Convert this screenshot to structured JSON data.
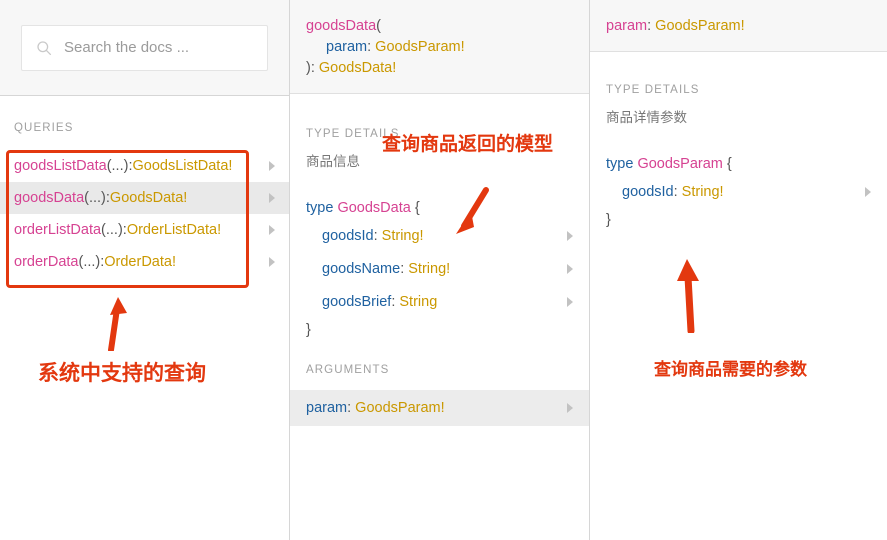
{
  "search": {
    "placeholder": "Search the docs ...",
    "value": "",
    "icon": "search-icon"
  },
  "sidebar": {
    "section_title": "QUERIES",
    "queries": [
      {
        "name": "goodsListData",
        "args": "(...)",
        "colon": ": ",
        "type": "GoodsListData!",
        "active": false
      },
      {
        "name": "goodsData",
        "args": "(...)",
        "colon": ": ",
        "type": "GoodsData!",
        "active": true
      },
      {
        "name": "orderListData",
        "args": "(...)",
        "colon": ": ",
        "type": "OrderListData!",
        "active": false
      },
      {
        "name": "orderData",
        "args": "(...)",
        "colon": ": ",
        "type": "OrderData!",
        "active": false
      }
    ]
  },
  "middle": {
    "header": {
      "field": "goodsData",
      "open_paren": "(",
      "arg_name": "param",
      "arg_colon": ": ",
      "arg_type": "GoodsParam!",
      "close": "): ",
      "return_type": "GoodsData!"
    },
    "type_details_title": "TYPE DETAILS",
    "description": "商品信息",
    "type_keyword": "type",
    "type_name": "GoodsData",
    "open_brace": "{",
    "close_brace": "}",
    "fields": [
      {
        "name": "goodsId",
        "colon": ": ",
        "type": "String!"
      },
      {
        "name": "goodsName",
        "colon": ": ",
        "type": "String!"
      },
      {
        "name": "goodsBrief",
        "colon": ": ",
        "type": "String"
      }
    ],
    "arguments_title": "ARGUMENTS",
    "arguments": [
      {
        "name": "param",
        "colon": ": ",
        "type": "GoodsParam!"
      }
    ]
  },
  "right": {
    "header": {
      "arg_name": "param",
      "arg_colon": ": ",
      "arg_type": "GoodsParam!"
    },
    "type_details_title": "TYPE DETAILS",
    "description": "商品详情参数",
    "type_keyword": "type",
    "type_name": "GoodsParam",
    "open_brace": "{",
    "close_brace": "}",
    "fields": [
      {
        "name": "goodsId",
        "colon": ": ",
        "type": "String!"
      }
    ]
  },
  "annotations": {
    "color": "#e3380f",
    "labels": [
      {
        "id": "queries-note",
        "text": "系统中支持的查询"
      },
      {
        "id": "return-model-note",
        "text": "查询商品返回的模型"
      },
      {
        "id": "param-note",
        "text": "查询商品需要的参数"
      }
    ]
  },
  "colors": {
    "field_pink": "#d64292",
    "type_orange": "#ca9800",
    "name_blue": "#1f61a0",
    "panel_bg": "#ffffff",
    "header_bg": "#f7f7f7",
    "row_active": "#e9e9e9",
    "annotation_red": "#e3380f"
  }
}
